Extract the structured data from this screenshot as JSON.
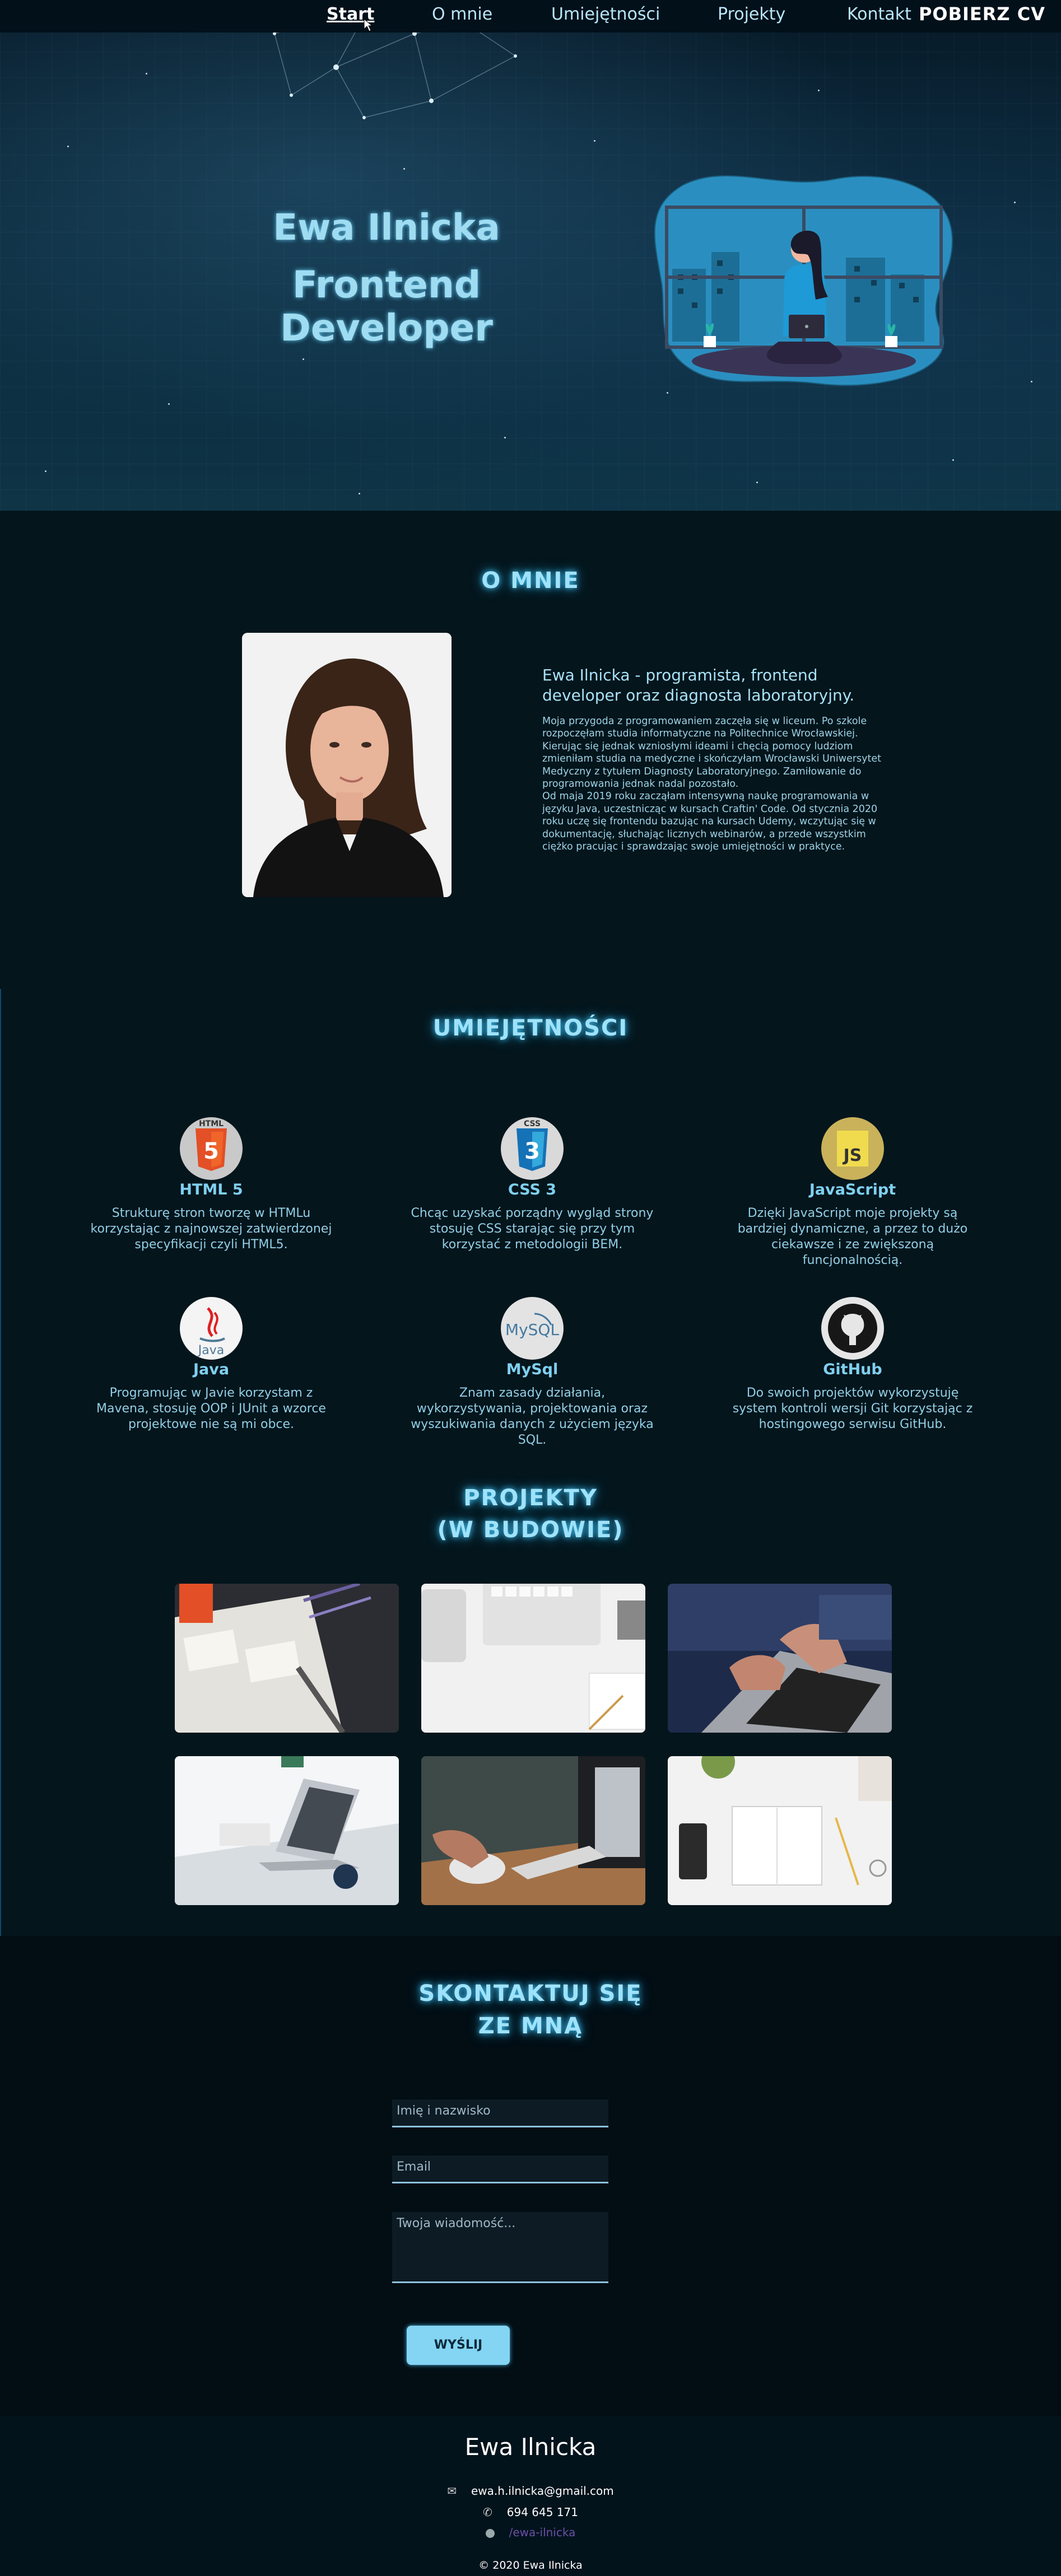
{
  "nav": {
    "items": [
      {
        "label": "Start",
        "active": true
      },
      {
        "label": "O mnie",
        "active": false
      },
      {
        "label": "Umiejętności",
        "active": false
      },
      {
        "label": "Projekty",
        "active": false
      },
      {
        "label": "Kontakt",
        "active": false
      }
    ],
    "cv_label": "POBIERZ CV"
  },
  "hero": {
    "name": "Ewa Ilnicka",
    "role": "Frontend Developer"
  },
  "about": {
    "title": "O MNIE",
    "heading": "Ewa Ilnicka - programista, frontend developer oraz diagnosta laboratoryjny.",
    "paragraph1": "Moja przygoda z programowaniem zaczęła się w liceum. Po szkole rozpoczęłam studia informatyczne na Politechnice Wrocławskiej. Kierując się jednak wzniosłymi ideami i chęcią pomocy ludziom zmieniłam studia na medyczne i skończyłam Wrocławski Uniwersytet Medyczny z tytułem Diagnosty Laboratoryjnego. Zamiłowanie do programowania jednak nadal pozostało.",
    "paragraph2": "Od maja 2019 roku zacząłam intensywną naukę programowania w języku Java, uczestnicząc w kursach Craftin' Code. Od stycznia 2020 roku uczę się frontendu bazując na kursach Udemy, wczytując się w dokumentację, słuchając licznych webinarów, a przede wszystkim ciężko pracując i sprawdzając swoje umiejętności w praktyce."
  },
  "skills": {
    "title": "UMIEJĘTNOŚCI",
    "items": [
      {
        "name": "HTML 5",
        "icon": "html5-icon",
        "logo": "HTML",
        "color": "#e34f26",
        "desc": "Strukturę stron tworzę w HTMLu korzystając z najnowszej zatwierdzonej specyfikacji czyli HTML5."
      },
      {
        "name": "CSS 3",
        "icon": "css3-icon",
        "logo": "CSS",
        "color": "#2965f1",
        "desc": "Chcąc uzyskać porządny wygląd strony stosuję CSS starając się przy tym korzystać z metodologii BEM."
      },
      {
        "name": "JavaScript",
        "icon": "javascript-icon",
        "logo": "JS",
        "color": "#f0db4f",
        "desc": "Dzięki JavaScript moje projekty są bardziej dynamiczne, a przez to dużo ciekawsze i ze zwiększoną funcjonalnością."
      },
      {
        "name": "Java",
        "icon": "java-icon",
        "logo": "Java",
        "color": "#e11f21",
        "desc": "Programując w Javie korzystam z Mavena, stosuję OOP i JUnit a wzorce projektowe nie są mi obce."
      },
      {
        "name": "MySql",
        "icon": "mysql-icon",
        "logo": "MySQL",
        "color": "#4479a1",
        "desc": "Znam zasady działania, wykorzystywania, projektowania oraz wyszukiwania danych z użyciem języka SQL."
      },
      {
        "name": "GitHub",
        "icon": "github-icon",
        "logo": "",
        "color": "#181717",
        "desc": "Do swoich projektów wykorzystuję system kontroli wersji Git korzystając z hostingowego serwisu GitHub."
      }
    ]
  },
  "projects": {
    "title_line1": "PROJEKTY",
    "title_line2": "(W BUDOWIE)"
  },
  "contact": {
    "title_line1": "SKONTAKTUJ SIĘ",
    "title_line2": "ZE MNĄ",
    "name_placeholder": "Imię i nazwisko",
    "email_placeholder": "Email",
    "message_placeholder": "Twoja wiadomość...",
    "send_label": "WYŚLIJ"
  },
  "footer": {
    "name": "Ewa Ilnicka",
    "email": "ewa.h.ilnicka@gmail.com",
    "phone": "694 645 171",
    "github": "/ewa-ilnicka",
    "copyright": "© 2020 Ewa Ilnicka"
  },
  "colors": {
    "background": "#04151c",
    "accent": "#84d4f4",
    "glow": "#38b9ea"
  }
}
